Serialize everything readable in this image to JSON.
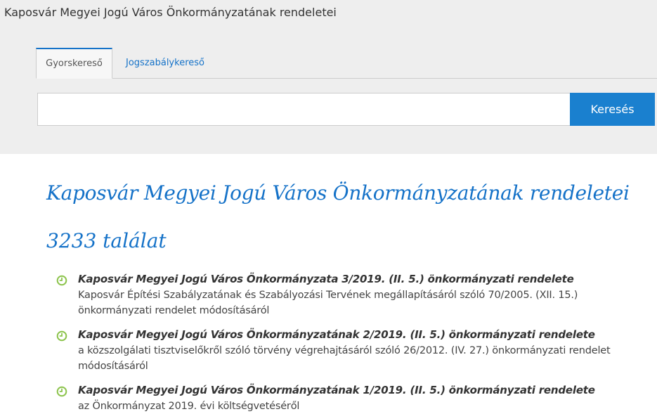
{
  "header": {
    "title": "Kaposvár Megyei Jogú Város Önkormányzatának rendeletei"
  },
  "tabs": [
    {
      "label": "Gyorskereső",
      "active": true
    },
    {
      "label": "Jogszabálykereső",
      "active": false
    }
  ],
  "search": {
    "value": "",
    "placeholder": "",
    "button_label": "Keresés"
  },
  "main": {
    "heading": "Kaposvár Megyei Jogú Város Önkormányzatának rendeletei",
    "result_count": "3233 találat"
  },
  "results": [
    {
      "icon": "clock-icon",
      "title": "Kaposvár Megyei Jogú Város Önkormányzata 3/2019. (II. 5.) önkormányzati rendelete",
      "description": "Kaposvár Építési Szabályzatának és Szabályozási Tervének megállapításáról szóló 70/2005. (XII. 15.) önkormányzati rendelet módosításáról"
    },
    {
      "icon": "clock-icon",
      "title": "Kaposvár Megyei Jogú Város Önkormányzatának 2/2019. (II. 5.) önkormányzati rendelete",
      "description": "a közszolgálati tisztviselőkről szóló törvény végrehajtásáról szóló 26/2012. (IV. 27.) önkormányzati rendelet módosításáról"
    },
    {
      "icon": "clock-icon",
      "title": "Kaposvár Megyei Jogú Város Önkormányzatának 1/2019. (II. 5.) önkormányzati rendelete",
      "description": "az Önkormányzat 2019. évi költségvetéséről"
    }
  ],
  "colors": {
    "accent": "#1572c8",
    "button": "#1a80cf",
    "icon": "#8bc34a",
    "header_bg": "#eeeeee"
  }
}
